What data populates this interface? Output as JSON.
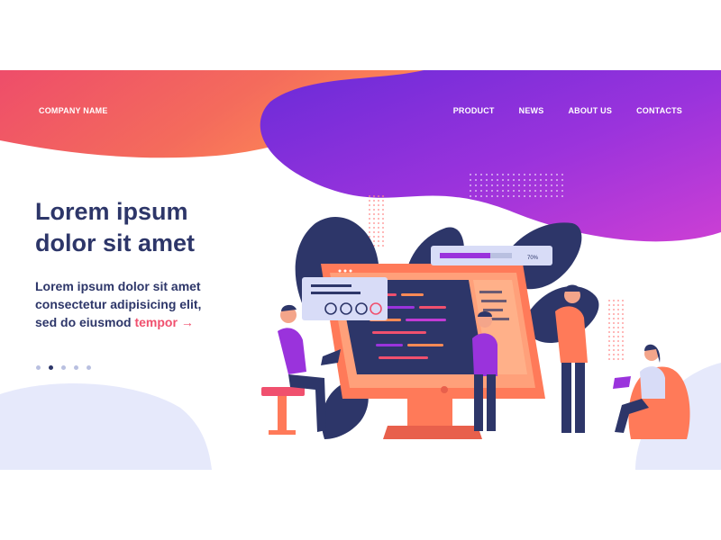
{
  "header": {
    "brand": "COMPANY NAME",
    "nav": [
      {
        "label": "PRODUCT"
      },
      {
        "label": "NEWS"
      },
      {
        "label": "ABOUT US"
      },
      {
        "label": "CONTACTS"
      }
    ]
  },
  "hero": {
    "title_line1": "Lorem ipsum",
    "title_line2": "dolor sit amet",
    "subtitle_line1": "Lorem ipsum dolor sit amet",
    "subtitle_line2": "consectetur adipisicing elit,",
    "subtitle_line3": "sed do eiusmod",
    "link_text": "tempor",
    "link_arrow": "→"
  },
  "slider": {
    "count": 5,
    "active_index": 1
  },
  "illustration": {
    "progress_label": "70%",
    "progress_value": 0.7
  },
  "colors": {
    "navy": "#2d3669",
    "coral": "#f0506e",
    "orange": "#ff7a59",
    "purple": "#7b2ff7",
    "magenta": "#c23bd4",
    "lavender": "#e6e9fb"
  }
}
